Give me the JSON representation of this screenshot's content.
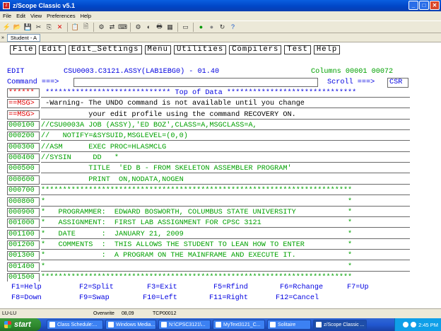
{
  "window": {
    "title": "z/Scope Classic v5.1",
    "minimize": "_",
    "maximize": "□",
    "close": "✕"
  },
  "menubar": [
    "File",
    "Edit",
    "View",
    "Preferences",
    "Help"
  ],
  "session_tab": "Student - A",
  "ispf_menu": [
    "File",
    "Edit",
    "Edit_Settings",
    "Menu",
    "Utilities",
    "Compilers",
    "Test",
    "Help"
  ],
  "header": {
    "mode": "EDIT",
    "dataset": "CSU0003.C3121.ASSY(LAB1EBG0) - 01.40",
    "columns": "Columns 00001 00072",
    "command_label": "Command ===>",
    "command_value": "",
    "scroll_label": "Scroll ===>",
    "scroll_value": "CSR"
  },
  "lines": [
    {
      "num": "******",
      "text": " ***************************** Top of Data ******************************",
      "numcolor": "red",
      "textcolor": "blue"
    },
    {
      "num": "==MSG>",
      "text": " -Warning- The UNDO command is not available until you change",
      "numcolor": "red",
      "textcolor": "black"
    },
    {
      "num": "==MSG>",
      "text": "           your edit profile using the command RECOVERY ON.",
      "numcolor": "red",
      "textcolor": "black"
    },
    {
      "num": "000100",
      "text": "//CSU0003A JOB (ASSY),'ED BOZ',CLASS=A,MSGCLASS=A,",
      "numcolor": "green",
      "textcolor": "green"
    },
    {
      "num": "000200",
      "text": "//   NOTIFY=&SYSUID,MSGLEVEL=(0,0)",
      "numcolor": "green",
      "textcolor": "green"
    },
    {
      "num": "000300",
      "text": "//ASM      EXEC PROC=HLASMCLG",
      "numcolor": "green",
      "textcolor": "green"
    },
    {
      "num": "000400",
      "text": "//SYSIN     DD   *",
      "numcolor": "green",
      "textcolor": "green"
    },
    {
      "num": "000500",
      "text": "           TITLE  'ED B - FROM SKELETON ASSEMBLER PROGRAM'",
      "numcolor": "green",
      "textcolor": "green"
    },
    {
      "num": "000600",
      "text": "           PRINT  ON,NODATA,NOGEN",
      "numcolor": "green",
      "textcolor": "green"
    },
    {
      "num": "000700",
      "text": "************************************************************************",
      "numcolor": "green",
      "textcolor": "green"
    },
    {
      "num": "000800",
      "text": "*                                                                      *",
      "numcolor": "green",
      "textcolor": "green"
    },
    {
      "num": "000900",
      "text": "*   PROGRAMMER:  EDWARD BOSWORTH, COLUMBUS STATE UNIVERSITY            *",
      "numcolor": "green",
      "textcolor": "green"
    },
    {
      "num": "001000",
      "text": "*   ASSIGNMENT:  FIRST LAB ASSIGNMENT FOR CPSC 3121                    *",
      "numcolor": "green",
      "textcolor": "green"
    },
    {
      "num": "001100",
      "text": "*   DATE      :  JANUARY 21, 2009                                      *",
      "numcolor": "green",
      "textcolor": "green"
    },
    {
      "num": "001200",
      "text": "*   COMMENTS  :  THIS ALLOWS THE STUDENT TO LEAN HOW TO ENTER          *",
      "numcolor": "green",
      "textcolor": "green"
    },
    {
      "num": "001300",
      "text": "*             :  A PROGRAM ON THE MAINFRAME AND EXECUTE IT.            *",
      "numcolor": "green",
      "textcolor": "green"
    },
    {
      "num": "001400",
      "text": "*                                                                      *",
      "numcolor": "green",
      "textcolor": "green"
    },
    {
      "num": "001500",
      "text": "************************************************************************",
      "numcolor": "green",
      "textcolor": "green"
    }
  ],
  "fkeys_row1": [
    "F1=Help",
    "F2=Split",
    "F3=Exit",
    "F5=Rfind",
    "F6=Rchange",
    "F7=Up"
  ],
  "fkeys_row2": [
    "F8=Down",
    "F9=Swap",
    "F10=Left",
    "F11=Right",
    "F12=Cancel"
  ],
  "status": {
    "lu": "LU-LU",
    "mode": "Overwrite",
    "pos": "08,09",
    "port": "TCP00012"
  },
  "taskbar": {
    "start": "start",
    "tasks": [
      "Class Schedule:...",
      "Windows Media...",
      "N:\\CPSC3121\\...",
      "MyText3121_C...",
      "Solitaire",
      "z/Scope Classic ..."
    ],
    "clock": "2:45 PM"
  },
  "colors": {
    "blue": "#0000e0",
    "green": "#00a000",
    "red": "#e00000"
  }
}
